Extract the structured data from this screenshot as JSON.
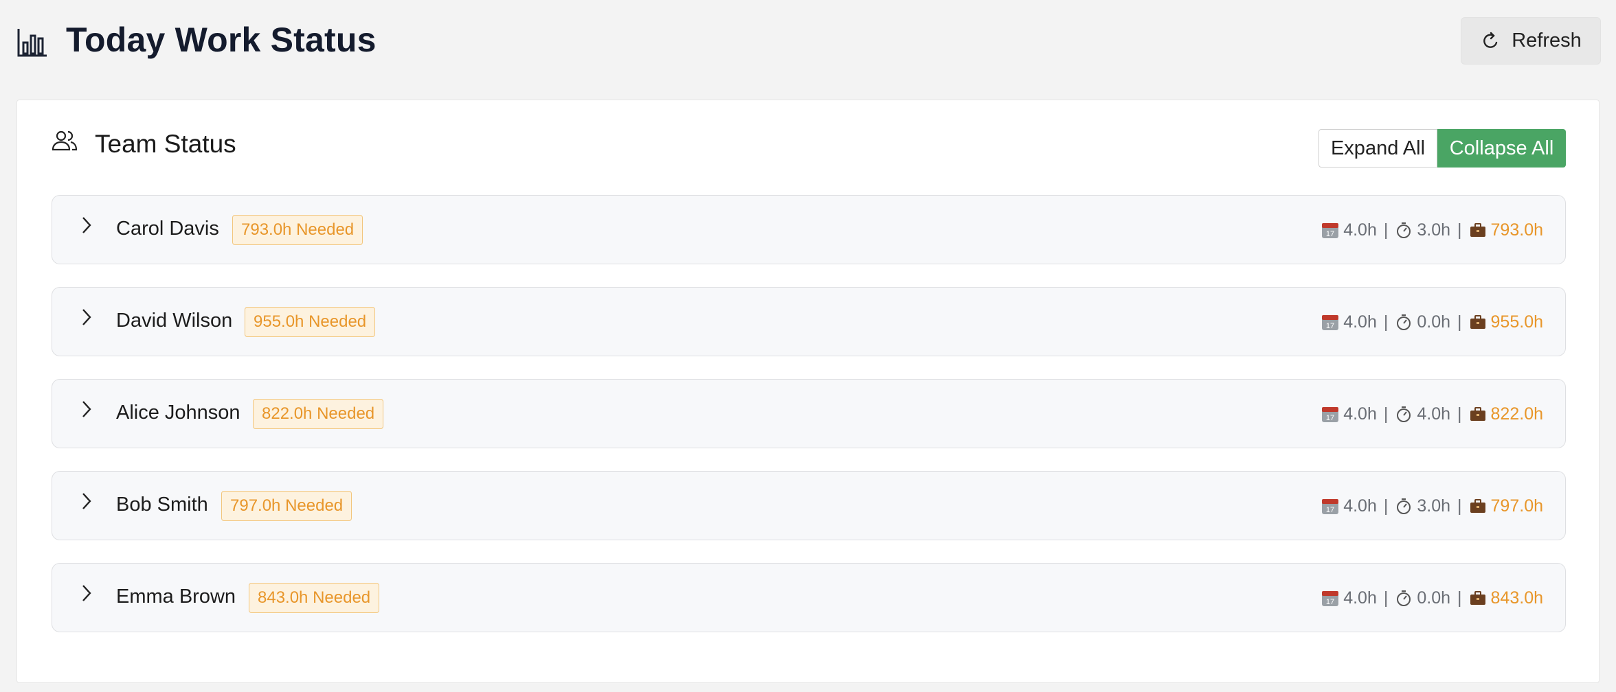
{
  "header": {
    "title": "Today Work Status",
    "refresh_label": "Refresh",
    "icon": "bar-chart-icon"
  },
  "team_card": {
    "title": "Team Status",
    "icon": "users-icon",
    "expand_label": "Expand All",
    "collapse_label": "Collapse All",
    "collapse_color": "#4aa564"
  },
  "members": [
    {
      "name": "Carol Davis",
      "badge": "793.0h Needed",
      "scheduled": "4.0h",
      "logged": "3.0h",
      "needed": "793.0h"
    },
    {
      "name": "David Wilson",
      "badge": "955.0h Needed",
      "scheduled": "4.0h",
      "logged": "0.0h",
      "needed": "955.0h"
    },
    {
      "name": "Alice Johnson",
      "badge": "822.0h Needed",
      "scheduled": "4.0h",
      "logged": "4.0h",
      "needed": "822.0h"
    },
    {
      "name": "Bob Smith",
      "badge": "797.0h Needed",
      "scheduled": "4.0h",
      "logged": "3.0h",
      "needed": "797.0h"
    },
    {
      "name": "Emma Brown",
      "badge": "843.0h Needed",
      "scheduled": "4.0h",
      "logged": "0.0h",
      "needed": "843.0h"
    }
  ],
  "colors": {
    "accent_green": "#4aa564",
    "warning_orange": "#e8962a",
    "badge_bg": "#fdf2df"
  }
}
